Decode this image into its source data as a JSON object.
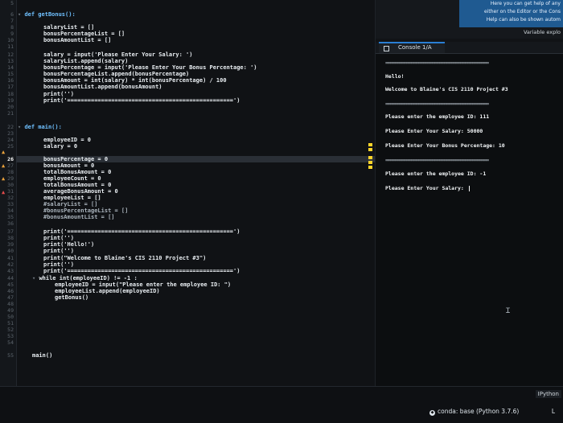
{
  "editor": {
    "line_numbers": [
      "5",
      "6",
      "7",
      "8",
      "9",
      "10",
      "11",
      "12",
      "13",
      "14",
      "15",
      "16",
      "17",
      "18",
      "19",
      "20",
      "21",
      "22",
      "23",
      "24",
      "25",
      "26",
      "27",
      "28",
      "29",
      "30",
      "31",
      "32",
      "33",
      "34",
      "35",
      "36",
      "37",
      "38",
      "39",
      "40",
      "41",
      "42",
      "43",
      "44",
      "45",
      "46",
      "47",
      "48",
      "49",
      "50",
      "51",
      "52",
      "53",
      "54",
      "55"
    ],
    "current_line": "26",
    "code": {
      "def_getbonus": "def getBonus():",
      "l8": "salaryList = []",
      "l9": "bonusPercentageList = []",
      "l10": "bonusAmountList = []",
      "l12": "salary = input('Please Enter Your Salary: ')",
      "l13": "salaryList.append(salary)",
      "l14": "bonusPercentage = input('Please Enter Your Bonus Percentage: ')",
      "l15": "bonusPercentageList.append(bonusPercentage)",
      "l16": "bonusAmount = int(salary) * int(bonusPercentage) / 100",
      "l17": "bonusAmountList.append(bonusAmount)",
      "l18": "print('')",
      "l19": "print('=================================================')",
      "def_main": "def main():",
      "l24": "employeeID = 0",
      "l25": "salary = 0",
      "l26": "bonusPercentage = 0",
      "l27": "bonusAmount = 0",
      "l28": "totalBonusAmount = 0",
      "l29": "employeeCount = 0",
      "l30": "totalBonusAmount = 0",
      "l31": "averageBonusAmount = 0",
      "l32": "employeeList = []",
      "l33": "#salaryList = []",
      "l34": "#bonusPercentageList = []",
      "l35": "#bonusAmountList = []",
      "l37": "print('=================================================')",
      "l38": "print('')",
      "l39": "print('Hello!')",
      "l40": "print('')",
      "l41": "print(\"Welcome to Blaine's CIS 2110 Project #3\")",
      "l42": "print('')",
      "l43": "print('=================================================')",
      "l44": "while int(employeeID) != -1 :",
      "l45": "employeeID = input(\"Please enter the employee ID: \")",
      "l46": "employeeList.append(employeeID)",
      "l47": "getBonus()",
      "l54": "main()"
    }
  },
  "help": {
    "line1": "Here you can get help of any",
    "line2": "either on the Editor or the Cons",
    "line3": "Help can also be shown autom",
    "tab_label": "Variable explo"
  },
  "console": {
    "tab_label": "Console 1/A",
    "rule": "============================================",
    "hello": "Hello!",
    "welcome": "Welcome to Blaine's CIS 2110 Project #3",
    "prompt_id_1": "Please enter the employee ID: 111",
    "prompt_salary_1": "Please Enter Your Salary: 50000",
    "prompt_bonus_1": "Please Enter Your Bonus Percentage: 10",
    "prompt_id_2": "Please enter the employee ID: -1",
    "prompt_salary_2": "Please Enter Your Salary: "
  },
  "status": {
    "ipython_tab": "IPython",
    "env": "conda: base (Python 3.7.6)",
    "right": "L"
  },
  "colors": {
    "accent": "#2a7fd4",
    "warning": "#e9a13b",
    "error": "#e34b4b",
    "marker": "#ffd42a"
  }
}
